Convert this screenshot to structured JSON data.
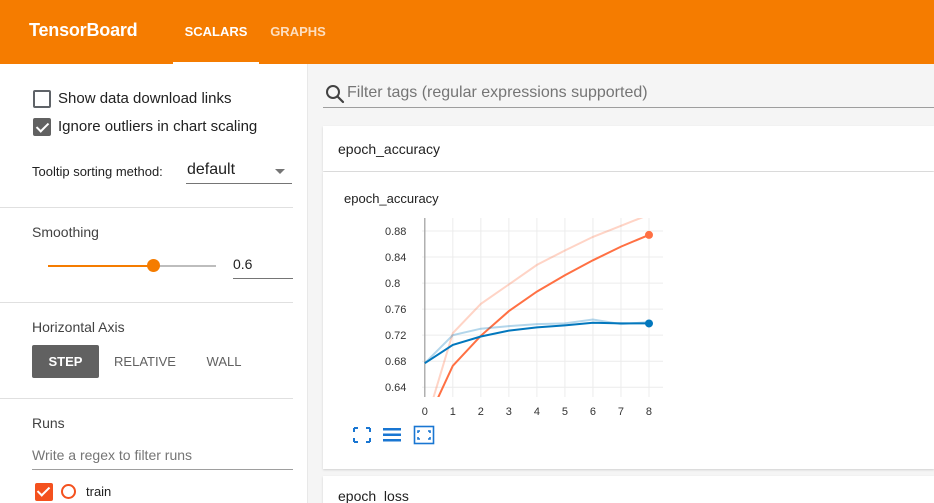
{
  "header": {
    "brand": "TensorBoard",
    "tabs": [
      {
        "label": "SCALARS",
        "active": true
      },
      {
        "label": "GRAPHS",
        "active": false
      }
    ],
    "color": "#f57c00"
  },
  "sidebar": {
    "show_download_links": {
      "label": "Show data download links",
      "checked": false
    },
    "ignore_outliers": {
      "label": "Ignore outliers in chart scaling",
      "checked": true
    },
    "tooltip_sorting": {
      "label": "Tooltip sorting method:",
      "value": "default"
    },
    "smoothing": {
      "title": "Smoothing",
      "value": "0.6",
      "fraction": 0.6
    },
    "horizontal_axis": {
      "title": "Horizontal Axis",
      "options": [
        "STEP",
        "RELATIVE",
        "WALL"
      ],
      "selected": "STEP"
    },
    "runs": {
      "title": "Runs",
      "filter_placeholder": "Write a regex to filter runs",
      "items": [
        {
          "label": "train",
          "checked": true,
          "color": "#f4511e"
        }
      ]
    }
  },
  "main": {
    "filter_placeholder": "Filter tags (regular expressions supported)",
    "cards": [
      {
        "title": "epoch_accuracy",
        "expanded": true
      },
      {
        "title": "epoch_loss",
        "expanded": false
      }
    ]
  },
  "chart_data": {
    "type": "line",
    "title": "epoch_accuracy",
    "xlabel": "",
    "ylabel": "",
    "x": [
      0,
      1,
      2,
      3,
      4,
      5,
      6,
      7,
      8
    ],
    "xticks": [
      0,
      1,
      2,
      3,
      4,
      5,
      6,
      7,
      8
    ],
    "yticks": [
      0.64,
      0.68,
      0.72,
      0.76,
      0.8,
      0.84,
      0.88
    ],
    "xlim": [
      -0.1,
      8.5
    ],
    "ylim": [
      0.625,
      0.9
    ],
    "grid": true,
    "series": [
      {
        "color": "#ff7043",
        "raw": [
          0.58,
          0.723,
          0.768,
          0.798,
          0.828,
          0.85,
          0.871,
          0.888,
          0.905
        ],
        "smoothed": [
          0.58,
          0.673,
          0.719,
          0.757,
          0.787,
          0.812,
          0.835,
          0.856,
          0.874
        ]
      },
      {
        "color": "#0277bd",
        "raw": [
          0.677,
          0.72,
          0.73,
          0.734,
          0.737,
          0.738,
          0.744,
          0.737,
          0.74
        ],
        "smoothed": [
          0.677,
          0.705,
          0.718,
          0.727,
          0.732,
          0.735,
          0.739,
          0.738,
          0.738
        ]
      }
    ]
  }
}
